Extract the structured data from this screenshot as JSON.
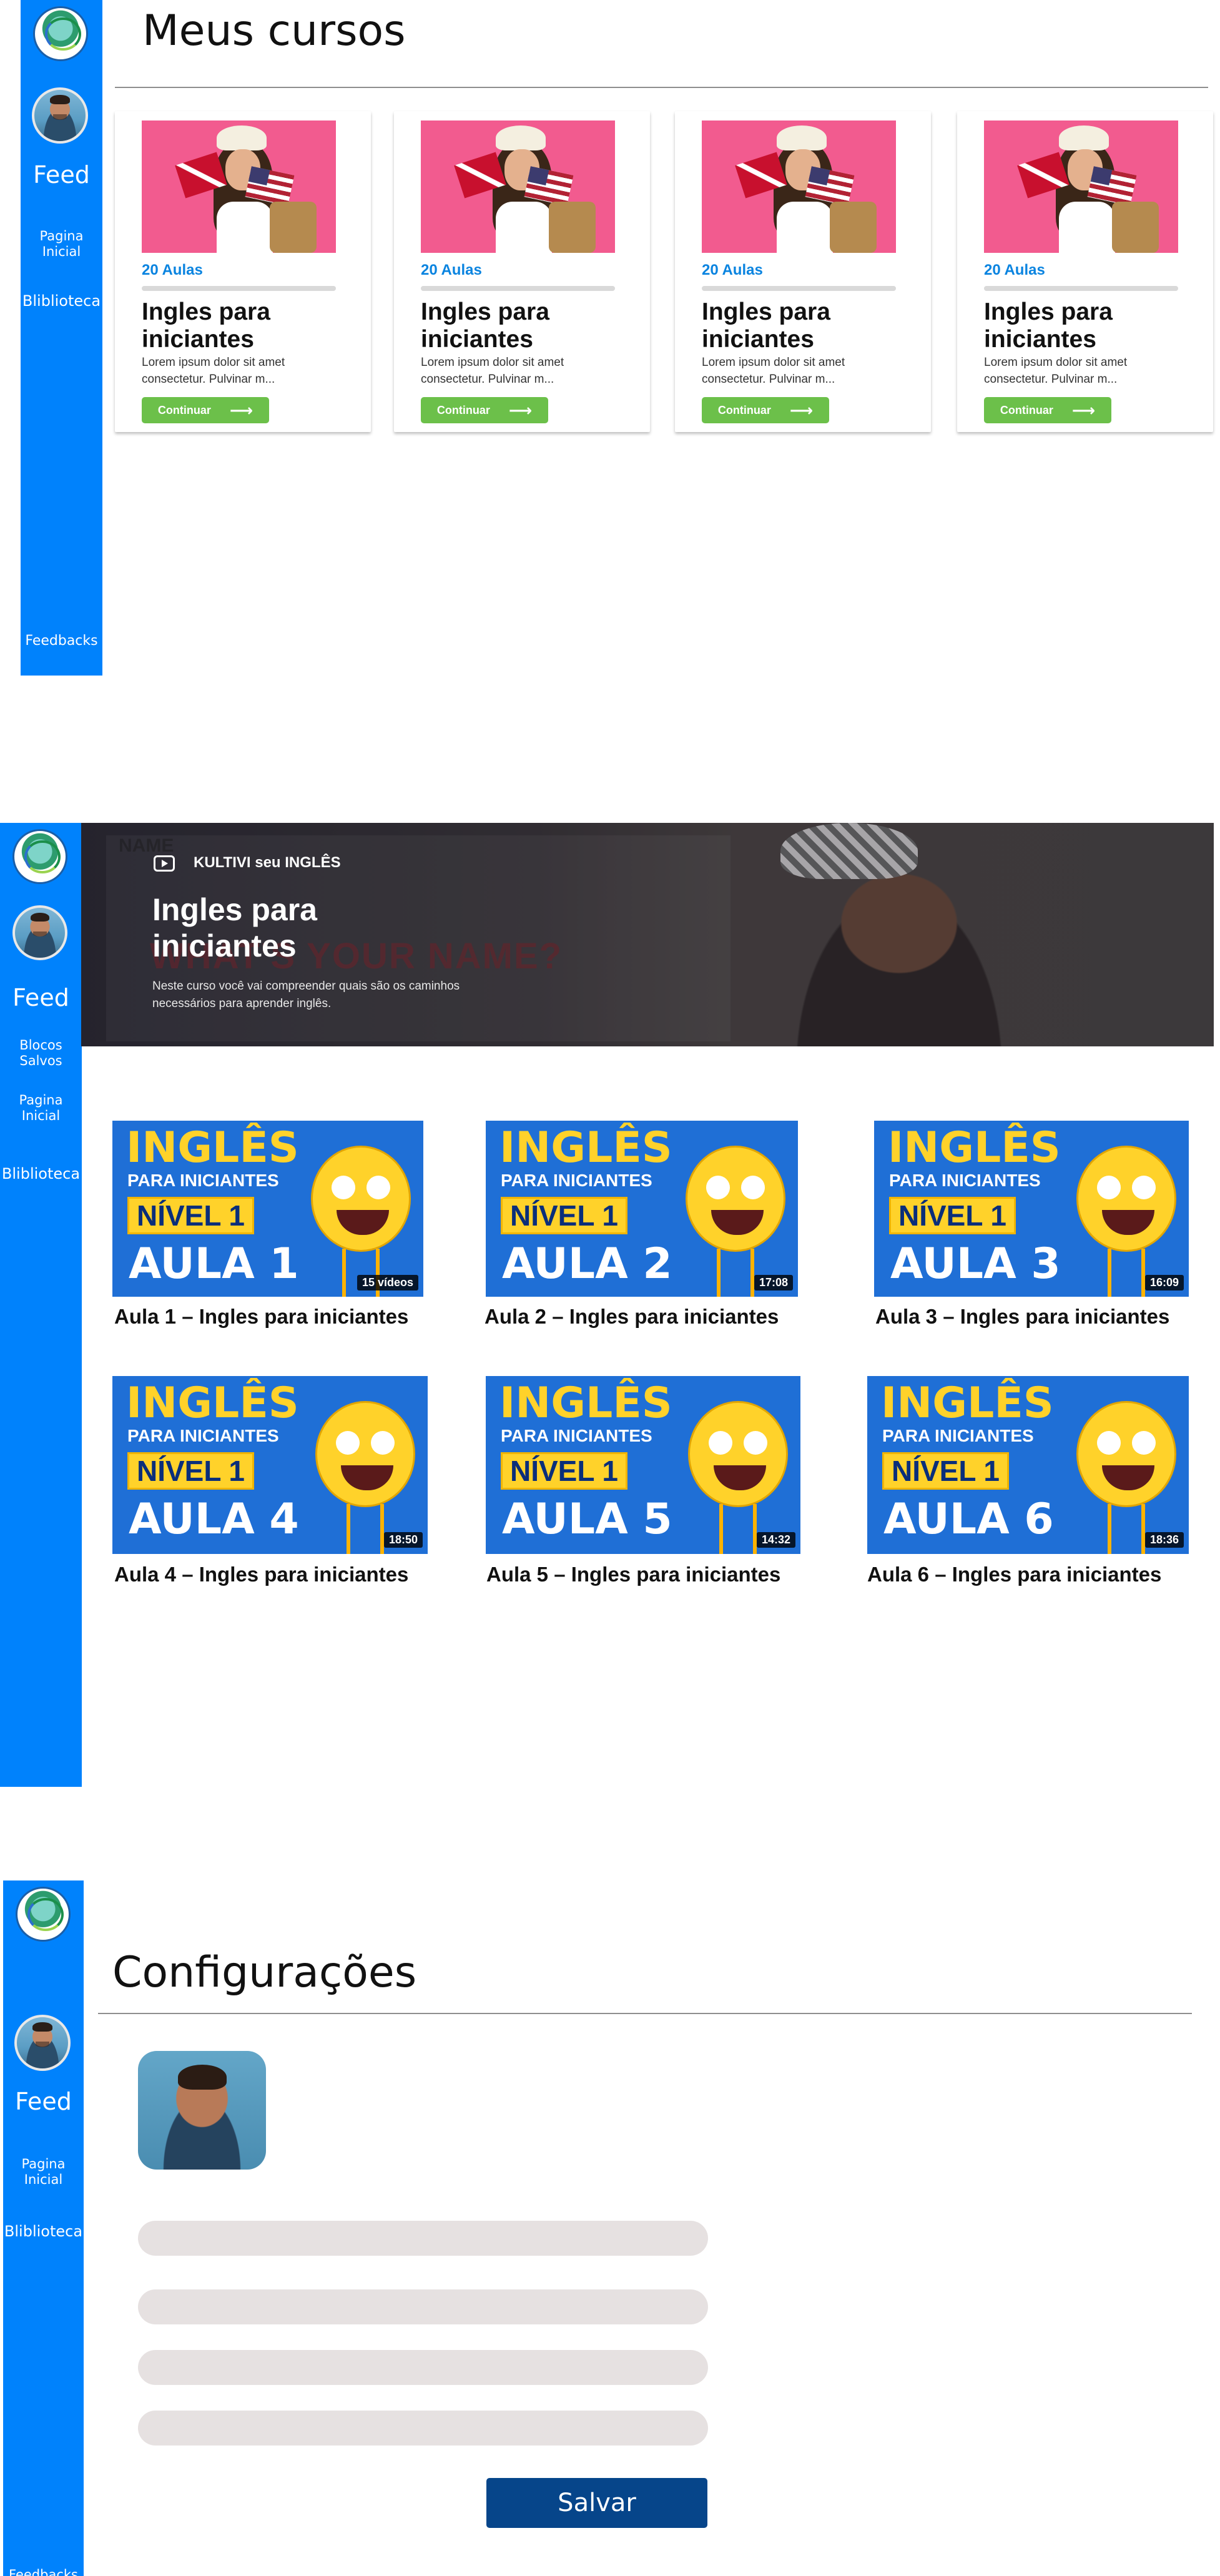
{
  "screens": {
    "courses": {
      "sidebar": {
        "feed": "Feed",
        "home": "Pagina\nInicial",
        "library": "Bliblioteca",
        "feedbacks": "Feedbacks"
      },
      "title": "Meus cursos",
      "cards": [
        {
          "lessons": "20 Aulas",
          "title": "Ingles para iniciantes",
          "desc": "Lorem ipsum dolor sit amet consectetur. Pulvinar m...",
          "button": "Continuar",
          "progress": 0
        },
        {
          "lessons": "20 Aulas",
          "title": "Ingles para iniciantes",
          "desc": "Lorem ipsum dolor sit amet consectetur. Pulvinar m...",
          "button": "Continuar",
          "progress": 0
        },
        {
          "lessons": "20 Aulas",
          "title": "Ingles para iniciantes",
          "desc": "Lorem ipsum dolor sit amet consectetur. Pulvinar m...",
          "button": "Continuar",
          "progress": 0
        },
        {
          "lessons": "20 Aulas",
          "title": "Ingles para iniciantes",
          "desc": "Lorem ipsum dolor sit amet consectetur. Pulvinar m...",
          "button": "Continuar",
          "progress": 0
        }
      ]
    },
    "course": {
      "sidebar": {
        "feed": "Feed",
        "saved": "Blocos\nSalvos",
        "home": "Pagina\nInicial",
        "library": "Bliblioteca"
      },
      "hero": {
        "channel": "KULTIVI seu INGLÊS",
        "title": "Ingles para iniciantes",
        "desc": "Neste curso você vai compreender quais são os caminhos necessários para aprender inglês.",
        "bg_text_1": "WHAT'S YOUR NAME?",
        "bg_text_2": "NAME"
      },
      "videos": [
        {
          "title": "Aula 1 – Ingles para iniciantes",
          "badge": "15 vídeos",
          "thumb": {
            "heading": "INGLÊS",
            "sub": "PARA INICIANTES",
            "level": "NÍVEL 1",
            "lesson": "AULA 1"
          }
        },
        {
          "title": "Aula 2 – Ingles para iniciantes",
          "badge": "17:08",
          "thumb": {
            "heading": "INGLÊS",
            "sub": "PARA INICIANTES",
            "level": "NÍVEL 1",
            "lesson": "AULA 2"
          }
        },
        {
          "title": "Aula 3 – Ingles para iniciantes",
          "badge": "16:09",
          "thumb": {
            "heading": "INGLÊS",
            "sub": "PARA INICIANTES",
            "level": "NÍVEL 1",
            "lesson": "AULA 3"
          }
        },
        {
          "title": "Aula 4 – Ingles para iniciantes",
          "badge": "18:50",
          "thumb": {
            "heading": "INGLÊS",
            "sub": "PARA INICIANTES",
            "level": "NÍVEL 1",
            "lesson": "AULA 4"
          }
        },
        {
          "title": "Aula 5 – Ingles para iniciantes",
          "badge": "14:32",
          "thumb": {
            "heading": "INGLÊS",
            "sub": "PARA INICIANTES",
            "level": "NÍVEL 1",
            "lesson": "AULA 5"
          }
        },
        {
          "title": "Aula 6 – Ingles para iniciantes",
          "badge": "18:36",
          "thumb": {
            "heading": "INGLÊS",
            "sub": "PARA INICIANTES",
            "level": "NÍVEL 1",
            "lesson": "AULA 6"
          }
        }
      ]
    },
    "settings": {
      "sidebar": {
        "feed": "Feed",
        "home": "Pagina\nInicial",
        "library": "Bliblioteca",
        "feedbacks": "Feedbacks"
      },
      "title": "Configurações",
      "fields": [
        "",
        "",
        "",
        ""
      ],
      "save_label": "Salvar"
    }
  },
  "colors": {
    "sidebar": "#0082fc",
    "lessons_text": "#0a84e0",
    "continue_button": "#6cc04a",
    "save_button": "#06458a",
    "field_bg": "#e6e1e1"
  },
  "icons": {
    "logo": "kultivi-logo-icon",
    "avatar": "user-avatar",
    "arrow": "arrow-right-icon",
    "play": "youtube-play-icon"
  }
}
